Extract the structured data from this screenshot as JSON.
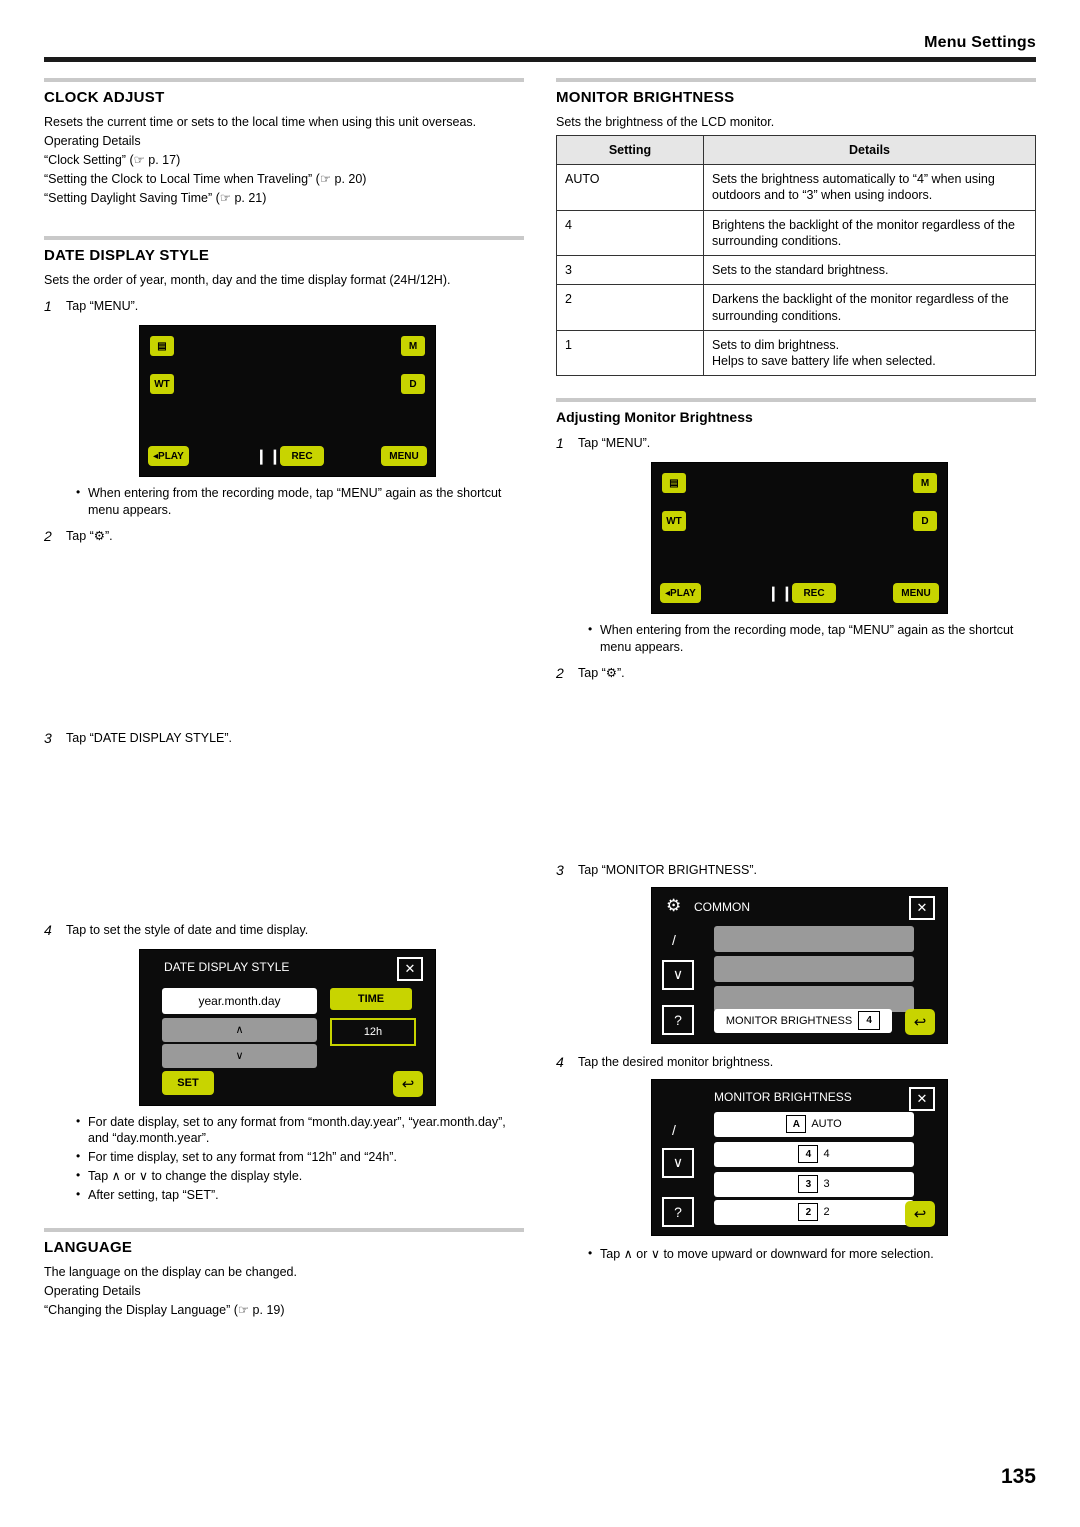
{
  "header": {
    "title": "Menu Settings"
  },
  "page_number": "135",
  "left": {
    "clock": {
      "heading": "CLOCK ADJUST",
      "desc": "Resets the current time or sets to the local time when using this unit overseas.",
      "operating_details_label": "Operating Details",
      "links": [
        "“Clock Setting” (☞ p. 17)",
        "“Setting the Clock to Local Time when Traveling” (☞ p. 20)",
        "“Setting Daylight Saving Time” (☞ p. 21)"
      ]
    },
    "date_display": {
      "heading": "DATE DISPLAY STYLE",
      "desc": "Sets the order of year, month, day and the time display format (24H/12H).",
      "step1_num": "1",
      "step1_text": "Tap “MENU”.",
      "bullet1": "When entering from the recording mode, tap “MENU” again as the shortcut menu appears.",
      "step2_num": "2",
      "step2_text": "Tap “⚙”.",
      "step3_num": "3",
      "step3_text": "Tap “DATE DISPLAY STYLE”.",
      "step4_num": "4",
      "step4_text": "Tap to set the style of date and time display.",
      "bullets": [
        "For date display, set to any format from “month.day.year”, “year.month.day”, and “day.month.year”.",
        "For time display, set to any format from “12h” and “24h”.",
        "Tap ∧ or ∨ to change the display style.",
        "After setting, tap “SET”."
      ]
    },
    "lcd": {
      "icon_top_left": "▤",
      "icon_mid_left": "WT",
      "icon_top_right": "M",
      "icon_mid_right": "D",
      "play_label": "PLAY",
      "rec_label": "REC",
      "menu_label": "MENU"
    },
    "date_dialog": {
      "title": "DATE DISPLAY STYLE",
      "close": "✕",
      "value": "year.month.day",
      "time_label": "TIME",
      "time_value": "12h",
      "up": "∧",
      "down": "∨",
      "set_label": "SET",
      "back": "↩"
    },
    "language": {
      "heading": "LANGUAGE",
      "desc": "The language on the display can be changed.",
      "operating_details_label": "Operating Details",
      "link": "“Changing the Display Language” (☞ p. 19)"
    }
  },
  "right": {
    "monitor": {
      "heading": "MONITOR BRIGHTNESS",
      "desc": "Sets the brightness of the LCD monitor.",
      "table": {
        "headers": [
          "Setting",
          "Details"
        ],
        "rows": [
          [
            "AUTO",
            "Sets the brightness automatically to “4” when using outdoors and to “3” when using indoors."
          ],
          [
            "4",
            "Brightens the backlight of the monitor regardless of the surrounding conditions."
          ],
          [
            "3",
            "Sets to the standard brightness."
          ],
          [
            "2",
            "Darkens the backlight of the monitor regardless of the surrounding conditions."
          ],
          [
            "1",
            "Sets to dim brightness.\nHelps to save battery life when selected."
          ]
        ]
      }
    },
    "adjusting": {
      "heading": "Adjusting Monitor Brightness",
      "step1_num": "1",
      "step1_text": "Tap “MENU”.",
      "bullet1": "When entering from the recording mode, tap “MENU” again as the shortcut menu appears.",
      "step2_num": "2",
      "step2_text": "Tap “⚙”.",
      "step3_num": "3",
      "step3_text": "Tap “MONITOR BRIGHTNESS”.",
      "step4_num": "4",
      "step4_text": "Tap the desired monitor brightness.",
      "bullet2": "Tap ∧ or ∨ to move upward or downward for more selection."
    },
    "lcd": {
      "icon_top_left": "▤",
      "icon_mid_left": "WT",
      "icon_top_right": "M",
      "icon_mid_right": "D",
      "play_label": "PLAY",
      "rec_label": "REC",
      "menu_label": "MENU"
    },
    "common_dialog": {
      "title": "COMMON",
      "close": "✕",
      "slash": "/",
      "down_arrow": "∨",
      "question": "?",
      "item_label": "MONITOR BRIGHTNESS",
      "item_value": "4",
      "back": "↩"
    },
    "brightness_dialog": {
      "title": "MONITOR BRIGHTNESS",
      "close": "✕",
      "slash": "/",
      "down_arrow": "∨",
      "question": "?",
      "options": [
        {
          "badge": "A",
          "label": "AUTO"
        },
        {
          "badge": "4",
          "label": "4"
        },
        {
          "badge": "3",
          "label": "3"
        },
        {
          "badge": "2",
          "label": "2"
        }
      ],
      "back": "↩"
    }
  }
}
